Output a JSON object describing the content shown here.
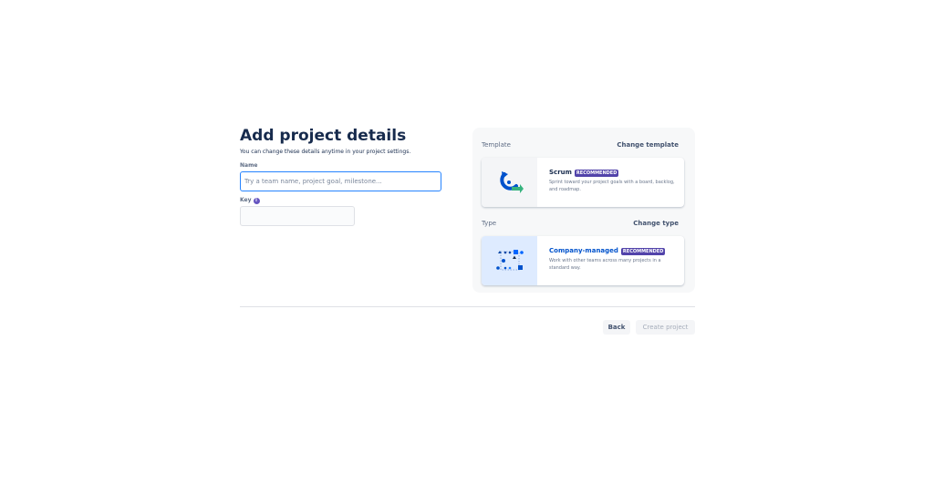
{
  "form": {
    "title": "Add project details",
    "subtitle": "You can change these details anytime in your project settings.",
    "name_label": "Name",
    "name_placeholder": "Try a team name, project goal, milestone...",
    "name_value": "",
    "key_label": "Key",
    "key_value": ""
  },
  "template": {
    "label": "Template",
    "change_label": "Change template",
    "card": {
      "title": "Scrum",
      "badge": "RECOMMENDED",
      "description": "Sprint toward your project goals with a board, backlog, and roadmap.",
      "icon": "scrum-icon"
    }
  },
  "type": {
    "label": "Type",
    "change_label": "Change type",
    "card": {
      "title": "Company-managed",
      "badge": "RECOMMENDED",
      "description": "Work with other teams across many projects in a standard way.",
      "icon": "company-managed-icon"
    }
  },
  "footer": {
    "back_label": "Back",
    "create_label": "Create project"
  },
  "colors": {
    "accent": "#2684FF",
    "badge": "#5243AA",
    "text_primary": "#172B4D",
    "scrum_blue": "#0052CC",
    "scrum_green": "#36B37E"
  }
}
